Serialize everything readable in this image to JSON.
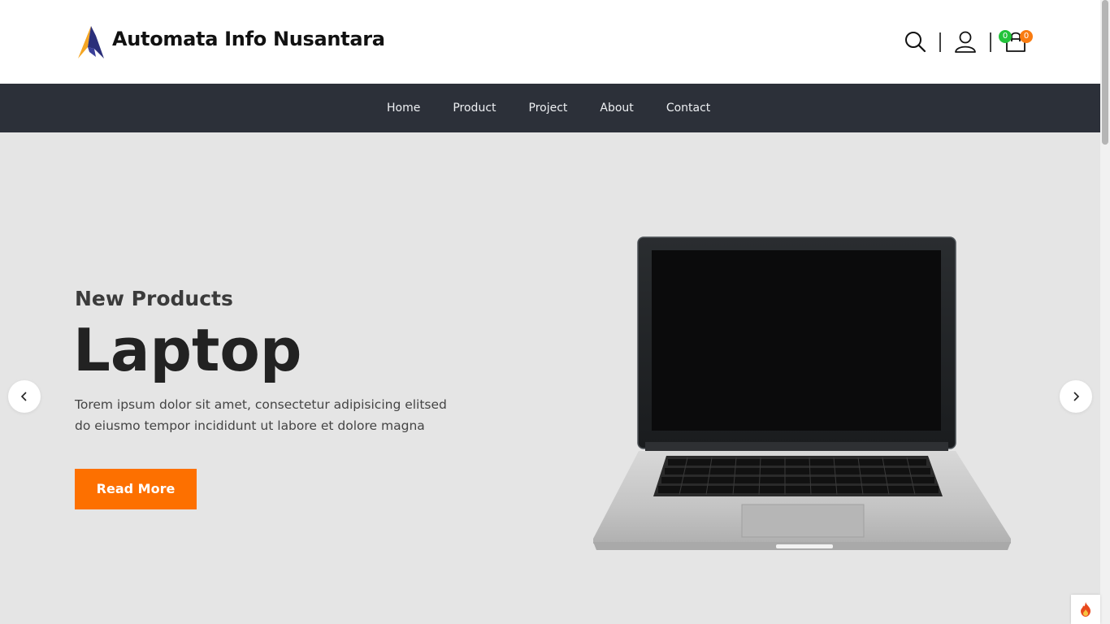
{
  "header": {
    "brand": "Automata Info Nusantara",
    "icons": {
      "search": "search-icon",
      "user": "user-icon",
      "cart": "shopping-bag-icon"
    },
    "wishlist_count": "0",
    "cart_count": "0"
  },
  "nav": {
    "items": [
      {
        "label": "Home"
      },
      {
        "label": "Product"
      },
      {
        "label": "Project"
      },
      {
        "label": "About"
      },
      {
        "label": "Contact"
      }
    ]
  },
  "hero": {
    "kicker": "New Products",
    "headline": "Laptop",
    "description": "Torem ipsum dolor sit amet, consectetur adipisicing elitsed do eiusmo tempor incididunt ut labore et dolore magna",
    "button_label": "Read More",
    "prev_icon": "chevron-left-icon",
    "next_icon": "chevron-right-icon",
    "image": "laptop-image"
  },
  "colors": {
    "accent": "#fd7000",
    "nav_bg": "#2c3039",
    "hero_bg": "#e5e5e5",
    "badge_green": "#22c33a",
    "badge_orange": "#f97b10"
  }
}
